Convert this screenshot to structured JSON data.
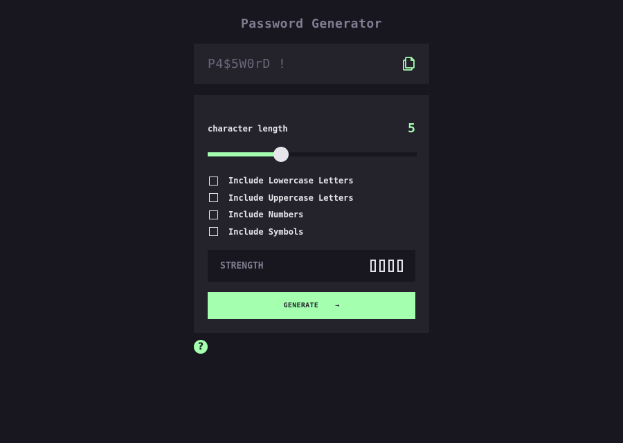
{
  "app": {
    "title": "Password Generator"
  },
  "output": {
    "password": "P4$5W0rD !",
    "copy_icon": "copy-icon"
  },
  "settings": {
    "length_label": "character length",
    "length_value": "5",
    "slider_fraction": 0.35
  },
  "options": [
    {
      "label": "Include Lowercase Letters",
      "checked": false
    },
    {
      "label": "Include Uppercase Letters",
      "checked": false
    },
    {
      "label": "Include Numbers",
      "checked": false
    },
    {
      "label": "Include Symbols",
      "checked": false
    }
  ],
  "strength": {
    "label": "STRENGTH",
    "bars_total": 4,
    "bars_filled": 0
  },
  "generate": {
    "label": "GENERATE",
    "arrow": "→"
  },
  "help": {
    "label": "?"
  },
  "colors": {
    "accent": "#a4ffaf",
    "background": "#18171f",
    "panel": "#24232c",
    "muted": "#817d92"
  }
}
